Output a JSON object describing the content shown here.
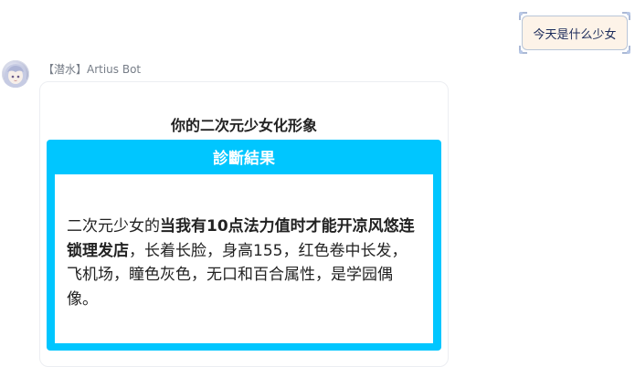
{
  "user_message": {
    "text": "今天是什么少女"
  },
  "bot": {
    "name": "【潜水】Artius Bot"
  },
  "card": {
    "title": "你的二次元少女化形象",
    "result_header": "診斷結果",
    "result_prefix": "二次元少女的",
    "result_bold": "当我有10点法力值时才能开凉风悠连锁理发店",
    "result_suffix": "，长着长脸，身高155，红色卷中长发，飞机场，瞳色灰色，无口和百合属性，是学园偶像。"
  },
  "colors": {
    "accent": "#00c6ff",
    "user_bubble_bg": "#fdf3e8",
    "user_bubble_border": "#b9c6d8",
    "user_text": "#1a2a5a"
  },
  "icons": {
    "avatar": "avatar-anime-girl",
    "bubble_corners": "bubble-corner-ornament"
  }
}
